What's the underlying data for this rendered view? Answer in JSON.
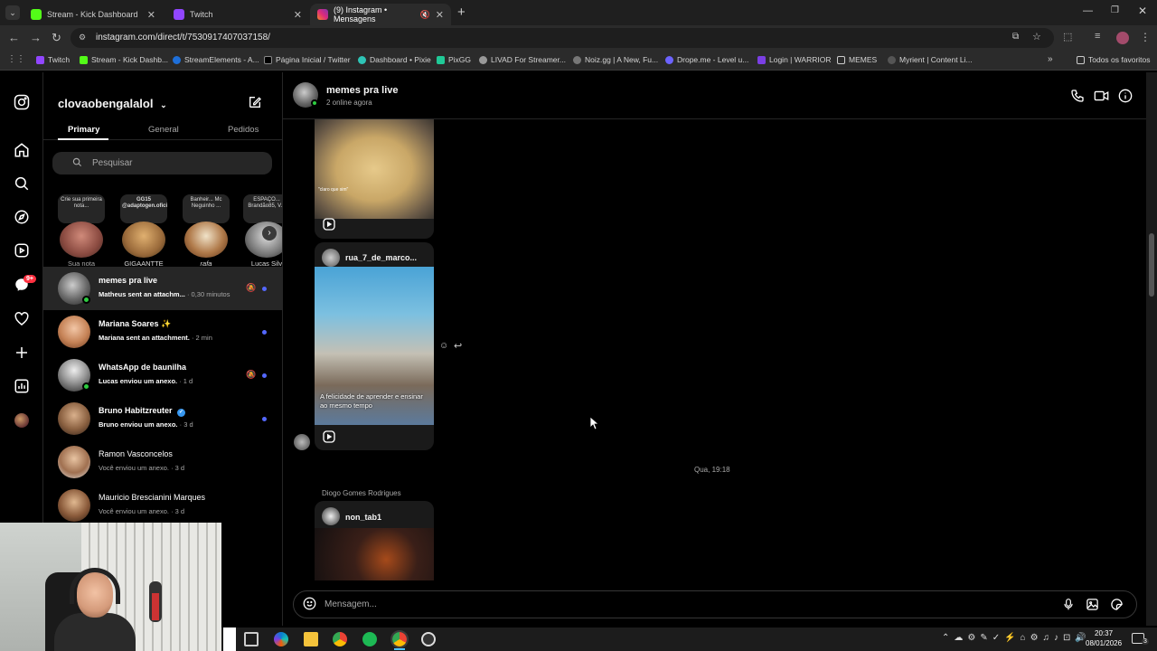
{
  "browser": {
    "tabs": [
      {
        "title": "Stream - Kick Dashboard",
        "active": false
      },
      {
        "title": "Twitch",
        "active": false
      },
      {
        "title": "(9) Instagram • Mensagens",
        "active": true
      }
    ],
    "new_tab": "+",
    "url": "instagram.com/direct/t/7530917407037158/",
    "bookmarks": [
      "Twitch",
      "Stream - Kick Dashb...",
      "StreamElements - A...",
      "Página Inicial / Twitter",
      "Dashboard • Pixie",
      "PixGG",
      "LIVAD For Streamer...",
      "Noiz.gg | A New, Fu...",
      "Drope.me - Level u...",
      "Login | WARRIOR",
      "MEMES",
      "Myrient | Content Li..."
    ],
    "all_bookmarks": "Todos os favoritos",
    "colors": {
      "tabbar": "#1f1f1f",
      "active_tab": "#2b2b2b",
      "kick": "#53fc18",
      "twitch": "#9146ff",
      "instagram": "#e1306c"
    }
  },
  "sidebar_nav": {
    "icons": [
      "instagram-logo-icon",
      "home-icon",
      "search-icon",
      "explore-icon",
      "reels-icon",
      "messenger-icon",
      "heart-icon",
      "create-icon",
      "dashboard-icon",
      "profile-avatar"
    ],
    "badge": "9+"
  },
  "inbox": {
    "username": "clovaobengalalol",
    "tabs": [
      "Primary",
      "General",
      "Pedidos"
    ],
    "active_tab": "Primary",
    "search_placeholder": "Pesquisar",
    "notes": [
      {
        "bubble": "Crie sua primeira nota...",
        "label": "Sua nota"
      },
      {
        "bubble": "GG15 @adaptogen.oficial",
        "label": "GIGAANTTE"
      },
      {
        "bubble": "Banheir... Mc Neguinho ...",
        "label": "rafa"
      },
      {
        "bubble": "ESPAÇO... Brandão85, V...",
        "label": "Lucas Silv"
      }
    ],
    "conversations": [
      {
        "name": "memes pra live",
        "preview": "Matheus sent an attachm...",
        "time": "· 0,30 minutos",
        "unread": true,
        "muted": true,
        "online": true
      },
      {
        "name": "Mariana Soares",
        "emoji": "✨",
        "preview": "Mariana sent an attachment.",
        "time": "· 2 min",
        "unread": true,
        "muted": false,
        "online": false
      },
      {
        "name": "WhatsApp de baunilha",
        "preview": "Lucas enviou um anexo.",
        "time": "· 1 d",
        "unread": true,
        "muted": true,
        "online": true
      },
      {
        "name": "Bruno Habitzreuter",
        "verified": true,
        "preview": "Bruno enviou um anexo.",
        "time": "· 3 d",
        "unread": true,
        "muted": false,
        "online": false
      },
      {
        "name": "Ramon Vasconcelos",
        "preview": "Você enviou um anexo.",
        "time": "· 3 d",
        "unread": false,
        "muted": false,
        "online": false
      },
      {
        "name": "Mauricio Brescianini Marques",
        "preview": "Você enviou um anexo.",
        "time": "· 3 d",
        "unread": false,
        "muted": false,
        "online": false
      }
    ]
  },
  "chat": {
    "title": "memes pra live",
    "status": "2 online agora",
    "messages": {
      "reel1_caption": "\"claro que sim\"",
      "reel2_user": "rua_7_de_marco...",
      "reel2_caption": "A felicidade de aprender e ensinar ao mesmo tempo",
      "timestamp": "Qua, 19:18",
      "sender": "Diogo Gomes Rodrigues",
      "reel3_user": "non_tab1"
    },
    "compose_placeholder": "Mensagem..."
  },
  "taskbar": {
    "time": "20:37",
    "date": "08/01/2026",
    "badge": "3"
  }
}
